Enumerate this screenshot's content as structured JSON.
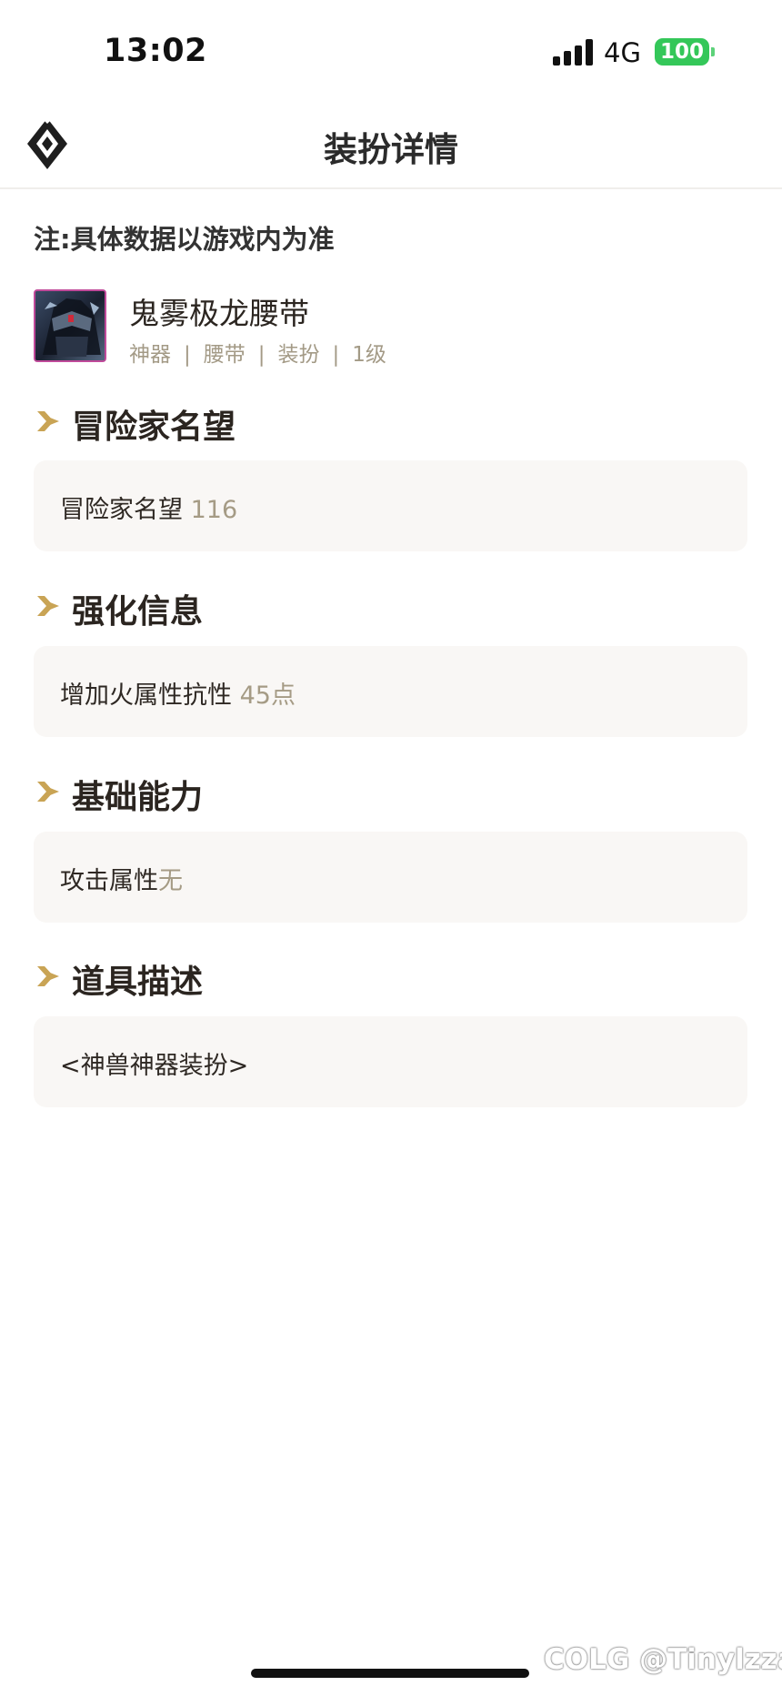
{
  "status_bar": {
    "time": "13:02",
    "network": "4G",
    "battery": "100",
    "battery_color": "#34c759"
  },
  "nav": {
    "title": "装扮详情",
    "logo_icon": "diamond-logo-icon"
  },
  "notice": "注:具体数据以游戏内为准",
  "item": {
    "name": "鬼雾极龙腰带",
    "tags": [
      "神器",
      "腰带",
      "装扮",
      "1级"
    ],
    "thumb_border_color": "#c04a9a"
  },
  "sections": [
    {
      "title": "冒险家名望",
      "label": "冒险家名望 ",
      "value": "116"
    },
    {
      "title": "强化信息",
      "label": "增加火属性抗性 ",
      "value": "45点"
    },
    {
      "title": "基础能力",
      "label": "攻击属性",
      "value": "无"
    },
    {
      "title": "道具描述",
      "label": "<神兽神器装扮>",
      "value": ""
    }
  ],
  "colors": {
    "accent": "#c9a455",
    "muted_value": "#a59b85",
    "card_bg": "#f9f7f5"
  },
  "watermark": "COLG @Tinylzzar"
}
